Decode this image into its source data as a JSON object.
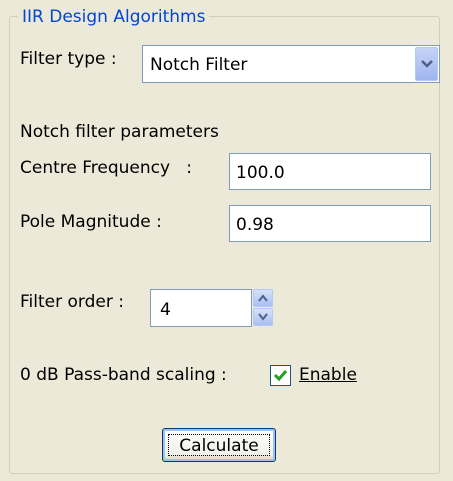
{
  "group": {
    "title": "IIR Design Algorithms"
  },
  "filter_type": {
    "label": "Filter type :",
    "value": "Notch Filter"
  },
  "section": {
    "heading": "Notch filter parameters"
  },
  "centre_frequency": {
    "label": "Centre Frequency   :",
    "value": "100.0"
  },
  "pole_magnitude": {
    "label": "Pole Magnitude :",
    "value": "0.98"
  },
  "filter_order": {
    "label": "Filter order :",
    "value": "4"
  },
  "scaling": {
    "label": "0 dB Pass-band scaling :",
    "checkbox_label": "Enable",
    "checked": true
  },
  "actions": {
    "calculate_label": "Calculate"
  },
  "colors": {
    "title": "#0046d5",
    "background": "#ece9d8",
    "border": "#7f9db9"
  }
}
